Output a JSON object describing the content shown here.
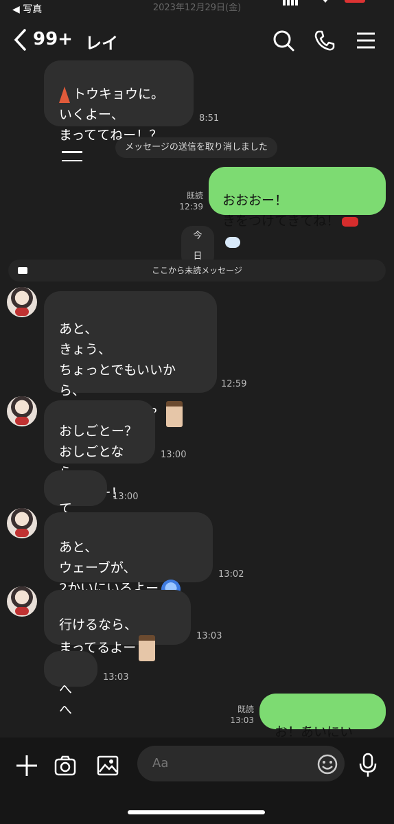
{
  "status_bar": {
    "back_app": "◀ 写真",
    "date": "2023年12月29日(金)"
  },
  "header": {
    "unread_count": "99+",
    "contact_name": "レイ"
  },
  "messages": [
    {
      "type": "in",
      "lines": "トウキョウに。\nいくよー、\nまっててねー！？",
      "time": "8:51"
    },
    {
      "type": "system",
      "text": "メッセージの送信を取り消しました"
    },
    {
      "type": "out",
      "lines": "おおおー！\nきをつけてきてね！",
      "read": "既読",
      "time": "12:39"
    },
    {
      "type": "date",
      "text": "今日"
    },
    {
      "type": "unread",
      "text": "ここから未読メッセージ"
    },
    {
      "type": "in",
      "lines": "あと、\nきょう、\nちょっとでもいいから、\nあいたいなー！？",
      "time": "12:59"
    },
    {
      "type": "in",
      "lines": "おしごとー？\nおしごとなら、\nいいよー！",
      "time": "13:00"
    },
    {
      "type": "in",
      "lines": "てへ、",
      "time": "13:00"
    },
    {
      "type": "in",
      "lines": "あと、\nウェーブが、\n2かいにいるよー",
      "time": "13:02"
    },
    {
      "type": "in",
      "lines": "行けるなら、\nまってるよー",
      "time": "13:03"
    },
    {
      "type": "in",
      "lines": "へへ",
      "time": "13:03"
    },
    {
      "type": "out",
      "lines": "お！あいにいく！",
      "read": "既読",
      "time": "13:03"
    }
  ],
  "input": {
    "placeholder": "Aa"
  },
  "colors": {
    "outgoing_bubble": "#7ddb72",
    "incoming_bubble": "#2f2f2f",
    "background": "#1e1e1e"
  }
}
